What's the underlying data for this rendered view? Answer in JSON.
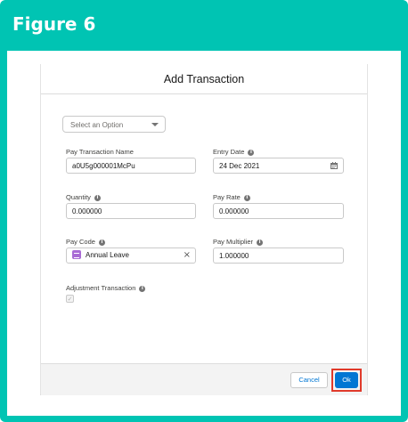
{
  "figure": {
    "title": "Figure 6"
  },
  "modal": {
    "title": "Add Transaction",
    "select": {
      "placeholder": "Select an Option"
    },
    "fields": {
      "pay_transaction_name": {
        "label": "Pay Transaction Name",
        "value": "a0U5g000001McPu"
      },
      "entry_date": {
        "label": "Entry Date",
        "value": "24 Dec 2021"
      },
      "quantity": {
        "label": "Quantity",
        "value": "0.000000"
      },
      "pay_rate": {
        "label": "Pay Rate",
        "value": "0.000000"
      },
      "pay_code": {
        "label": "Pay Code",
        "value": "Annual Leave"
      },
      "pay_multiplier": {
        "label": "Pay Multiplier",
        "value": "1.000000"
      },
      "adjustment_transaction": {
        "label": "Adjustment Transaction",
        "checked": true
      }
    },
    "buttons": {
      "cancel": "Cancel",
      "ok": "Ok"
    }
  },
  "icons": {
    "info": "i",
    "check": "✓",
    "clear": "×"
  },
  "colors": {
    "frame": "#00c4b3",
    "brand_blue": "#0176d3",
    "highlight_red": "#e03a2b",
    "pay_code_icon": "#a96bd5"
  }
}
